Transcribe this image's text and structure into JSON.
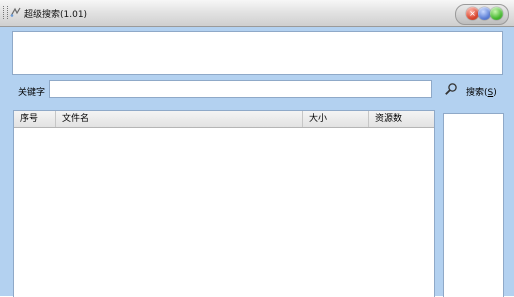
{
  "window": {
    "title": "超级搜索(1.01)"
  },
  "search": {
    "keyword_label": "关键字",
    "keyword_value": "",
    "button_label": "搜索(",
    "button_accel": "S",
    "button_suffix": ")"
  },
  "table": {
    "columns": [
      "序号",
      "文件名",
      "大小",
      "资源数"
    ],
    "rows": []
  },
  "colors": {
    "client_background": "#b3d1f0",
    "border": "#8fa9c8"
  }
}
